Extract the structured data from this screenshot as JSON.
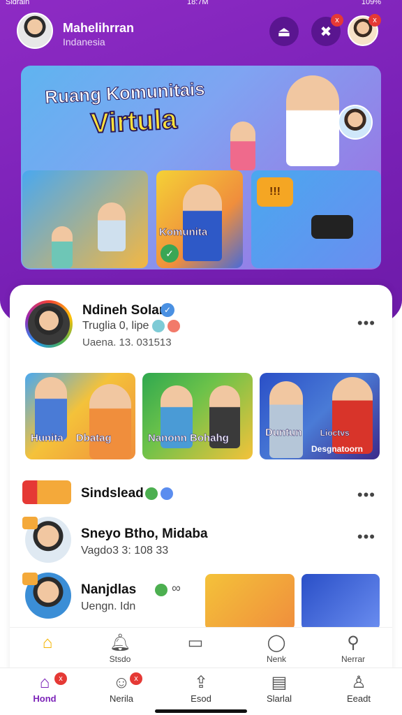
{
  "status_bar": {
    "carrier": "Sldrain",
    "time": "18:7M",
    "battery": "109%"
  },
  "header": {
    "title": "Mahelihrran",
    "subtitle": "Indanesia",
    "notif_badge": "x",
    "profile_badge": "x"
  },
  "hero": {
    "title_line1": "Ruang Komunitais",
    "title_line2": "Virtula",
    "panel_label": "Komunita",
    "panel_box": "!!!"
  },
  "post": {
    "name": "Ndineh Solar",
    "meta1": "Truglia 0, lipe",
    "meta2": "Uaena. 13. 031513",
    "thumbnails": [
      {
        "label": "Hunita",
        "label2": "Dbatag"
      },
      {
        "label": "Nanonn Bohahg"
      },
      {
        "label": "Duntun",
        "label2": "Lioctvs",
        "label3": "Desgnatoorn"
      }
    ]
  },
  "list": [
    {
      "name": "Sindslead"
    },
    {
      "name": "Sneyo Btho, Midaba",
      "sub": "Vagdo3 3: 108 33"
    },
    {
      "name": "Nanjdlas",
      "sub": "Uengn. Idn"
    }
  ],
  "subnav": [
    {
      "label": "",
      "icon": "home-icon"
    },
    {
      "label": "Stsdo",
      "icon": "bell-icon"
    },
    {
      "label": "",
      "icon": "calendar-icon"
    },
    {
      "label": "Nenk",
      "icon": "chat-icon"
    },
    {
      "label": "Nerrar",
      "icon": "person-search-icon"
    }
  ],
  "bottom_nav": [
    {
      "label": "Hond",
      "icon": "home-icon",
      "badge": "x"
    },
    {
      "label": "Nerila",
      "icon": "chat-icon",
      "badge": "x"
    },
    {
      "label": "Esod",
      "icon": "share-icon"
    },
    {
      "label": "Slarlal",
      "icon": "list-icon"
    },
    {
      "label": "Eeadt",
      "icon": "profile-icon"
    }
  ],
  "colors": {
    "brand_purple": "#7b22b8",
    "accent_yellow": "#ffd43b",
    "badge_red": "#e53935"
  }
}
